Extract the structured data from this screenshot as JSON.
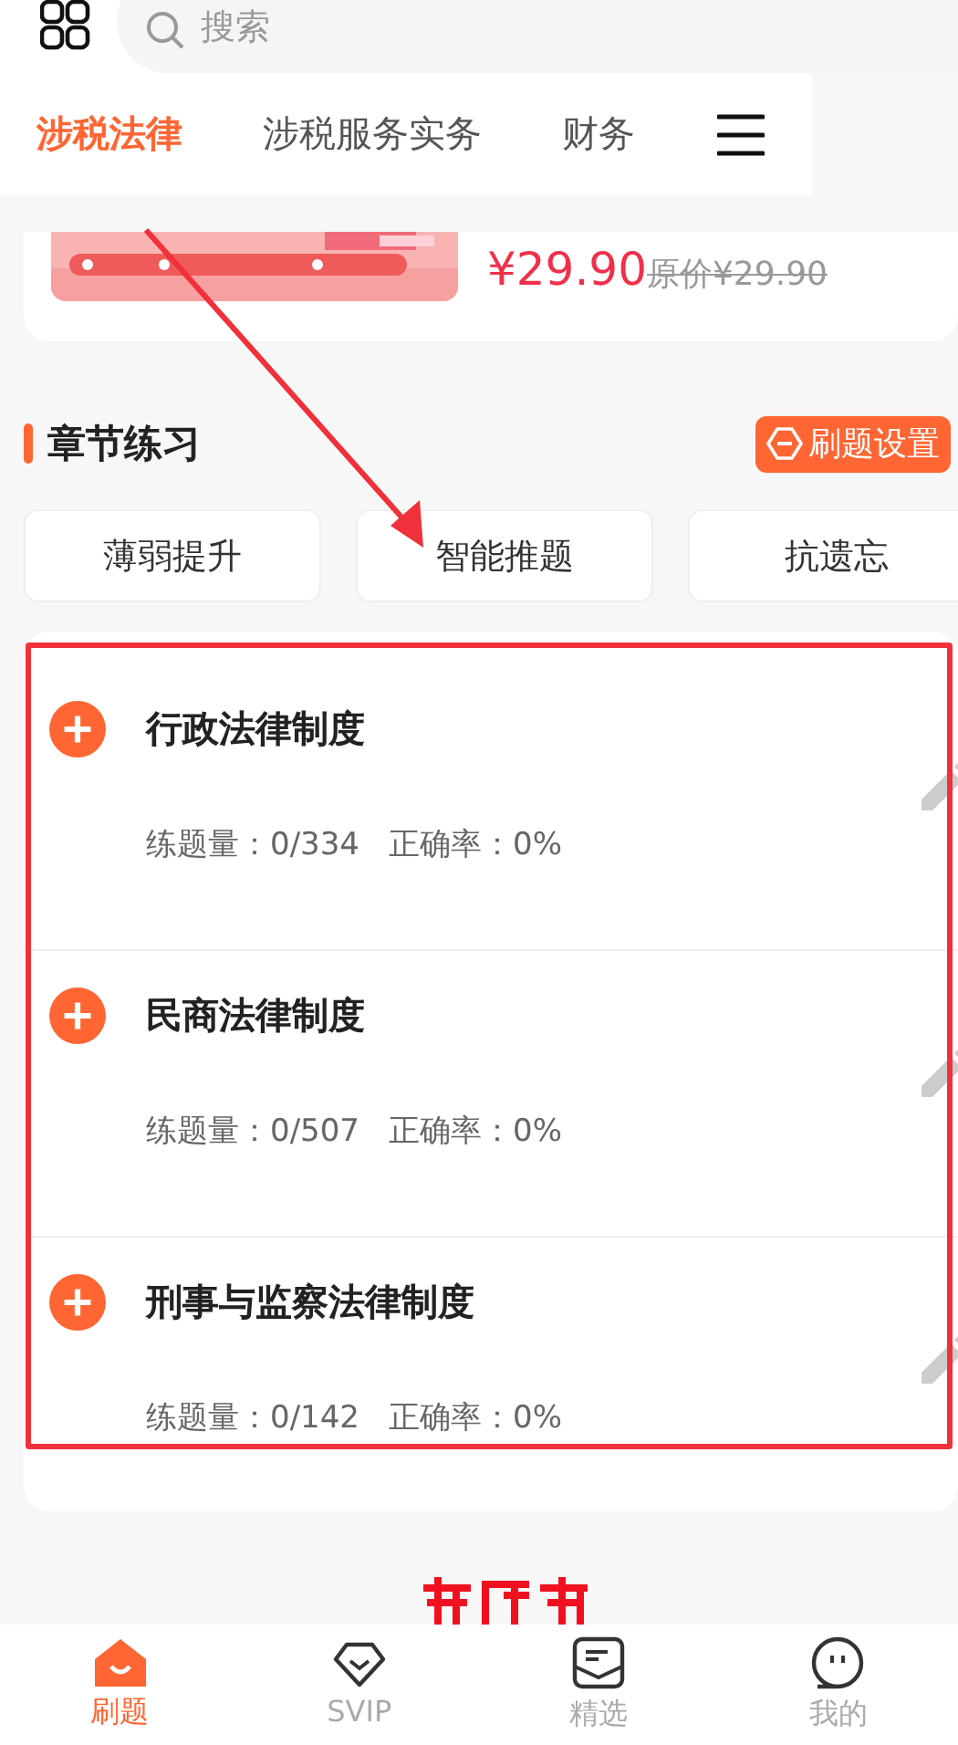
{
  "search": {
    "placeholder": "搜索"
  },
  "tabs": [
    {
      "label": "涉税法律",
      "selected": true
    },
    {
      "label": "涉税服务实务",
      "selected": false
    },
    {
      "label": "财务",
      "selected": false
    }
  ],
  "product": {
    "price": "¥29.90",
    "original_price": "原价¥29.90"
  },
  "section": {
    "title": "章节练习",
    "settings_button": "刷题设置"
  },
  "modes": [
    "薄弱提升",
    "智能推题",
    "抗遗忘"
  ],
  "chapters": [
    {
      "title": "行政法律制度",
      "count_label": "练题量：0/334",
      "accuracy_label": "正确率：0%"
    },
    {
      "title": "民商法律制度",
      "count_label": "练题量：0/507",
      "accuracy_label": "正确率：0%"
    },
    {
      "title": "刑事与监察法律制度",
      "count_label": "练题量：0/142",
      "accuracy_label": "正确率：0%"
    }
  ],
  "bottom_nav": [
    {
      "label": "刷题",
      "kind": "home",
      "selected": true
    },
    {
      "label": "SVIP",
      "kind": "diamond",
      "selected": false
    },
    {
      "label": "精选",
      "kind": "mail",
      "selected": false
    },
    {
      "label": "我的",
      "kind": "chat",
      "selected": false
    }
  ]
}
